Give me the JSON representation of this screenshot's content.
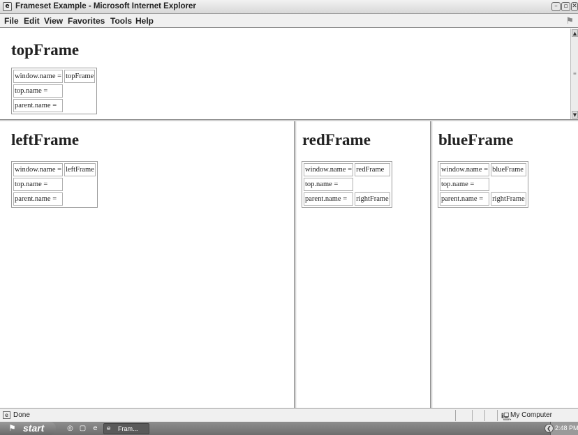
{
  "window": {
    "title": "Frameset Example - Microsoft Internet Explorer",
    "app_icon": "ie-page-icon",
    "minimize_glyph": "–",
    "maximize_glyph": "▫",
    "close_glyph": "✕"
  },
  "menu": {
    "items": [
      "File",
      "Edit",
      "View",
      "Favorites",
      "Tools",
      "Help"
    ]
  },
  "frames": {
    "top": {
      "heading": "topFrame",
      "rows": [
        {
          "label": "window.name =",
          "value": "topFrame"
        },
        {
          "label": "top.name =",
          "value": ""
        },
        {
          "label": "parent.name =",
          "value": ""
        }
      ]
    },
    "left": {
      "heading": "leftFrame",
      "rows": [
        {
          "label": "window.name =",
          "value": "leftFrame"
        },
        {
          "label": "top.name =",
          "value": ""
        },
        {
          "label": "parent.name =",
          "value": ""
        }
      ]
    },
    "red": {
      "heading": "redFrame",
      "rows": [
        {
          "label": "window.name =",
          "value": "redFrame"
        },
        {
          "label": "top.name =",
          "value": ""
        },
        {
          "label": "parent.name =",
          "value": "rightFrame"
        }
      ]
    },
    "blue": {
      "heading": "blueFrame",
      "rows": [
        {
          "label": "window.name =",
          "value": "blueFrame"
        },
        {
          "label": "top.name =",
          "value": ""
        },
        {
          "label": "parent.name =",
          "value": "rightFrame"
        }
      ]
    }
  },
  "statusbar": {
    "text": "Done",
    "zone": "My Computer"
  },
  "taskbar": {
    "start_label": "start",
    "task_label": "Fram...",
    "clock": "2:48 PM"
  },
  "colors": {
    "chrome": "#f0f0f0",
    "taskbar": "#7a7a7a"
  }
}
